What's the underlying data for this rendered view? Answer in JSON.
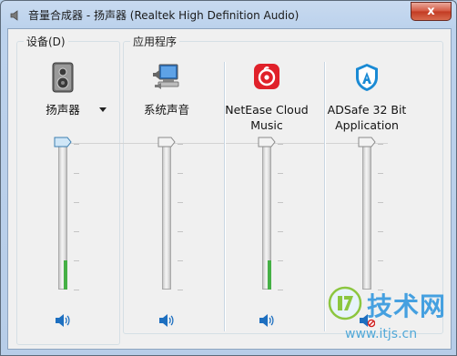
{
  "window": {
    "title": "音量合成器 - 扬声器 (Realtek High Definition Audio)",
    "close_label": "x"
  },
  "device_group": {
    "label": "设备(D)",
    "channel": {
      "name": "扬声器",
      "icon": "speaker-device-icon",
      "volume_percent": 100,
      "peak_level_percent": 20,
      "muted": false
    }
  },
  "apps_group": {
    "label": "应用程序",
    "channels": [
      {
        "name": "系统声音",
        "icon": "system-sounds-icon",
        "volume_percent": 100,
        "peak_level_percent": 0,
        "muted": false
      },
      {
        "name": "NetEase Cloud Music",
        "icon": "netease-cloud-music-icon",
        "volume_percent": 100,
        "peak_level_percent": 20,
        "muted": false
      },
      {
        "name": "ADSafe 32 Bit Application",
        "icon": "adsafe-icon",
        "volume_percent": 100,
        "peak_level_percent": 0,
        "muted": true
      }
    ]
  },
  "watermark": {
    "brand": "技术网",
    "url": "www.itjs.cn"
  },
  "colors": {
    "level": "#45b045",
    "netease": "#e0212a",
    "adsafe": "#1a8ad4",
    "close": "#c8432b"
  }
}
